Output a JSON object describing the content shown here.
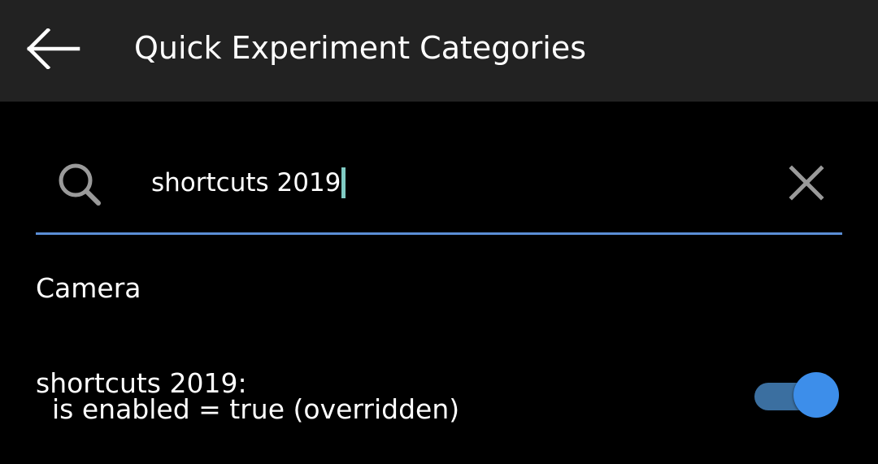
{
  "toolbar": {
    "title": "Quick Experiment Categories",
    "back_icon": "arrow-left-icon"
  },
  "search": {
    "icon": "search-icon",
    "value": "shortcuts 2019",
    "clear_icon": "close-icon",
    "caret_color": "#80cbc4",
    "underline_color": "#5b8ed6"
  },
  "category": {
    "name": "Camera"
  },
  "experiments": [
    {
      "name": "shortcuts 2019:",
      "status": "is enabled = true (overridden)",
      "enabled": true
    }
  ],
  "colors": {
    "toolbar_bg": "#222222",
    "background": "#000000",
    "toggle_track": "#3b6fa0",
    "toggle_thumb": "#3d8eea"
  }
}
